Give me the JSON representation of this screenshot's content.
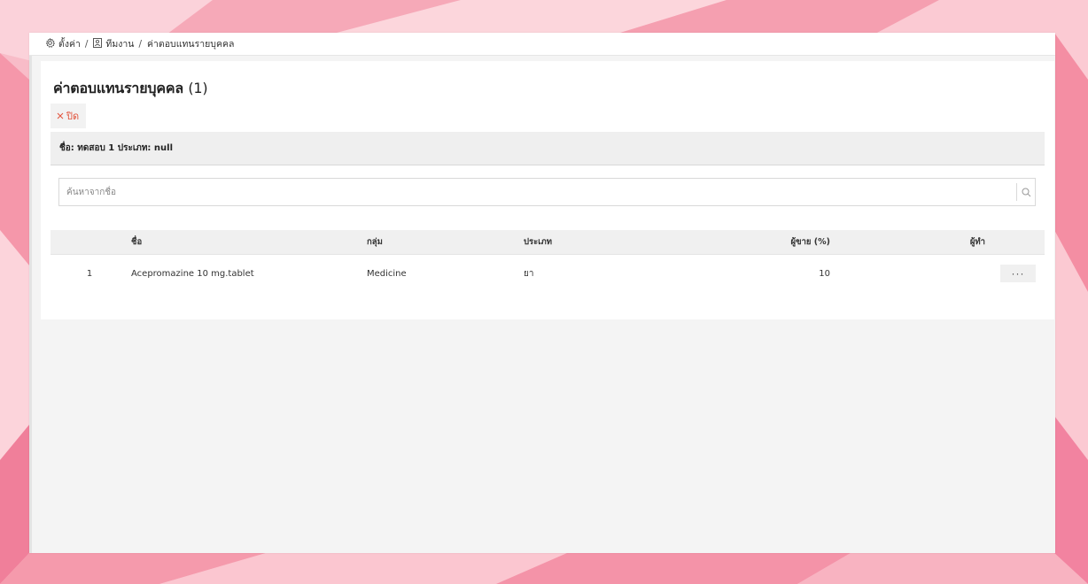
{
  "breadcrumb": {
    "items": [
      {
        "label": "ตั้งค่า",
        "icon": "gear-icon"
      },
      {
        "label": "ทีมงาน",
        "icon": "person-icon"
      },
      {
        "label": "ค่าตอบแทนรายบุคคล"
      }
    ],
    "separator": "/"
  },
  "page": {
    "title": "ค่าตอบแทนรายบุคคล",
    "count": "(1)",
    "close_label": "ปิด",
    "info": "ชื่อ: ทดสอบ 1 ประเภท: null"
  },
  "search": {
    "placeholder": "ค้นหาจากชื่อ",
    "value": ""
  },
  "table": {
    "columns": {
      "name": "ชื่อ",
      "group": "กลุ่ม",
      "type": "ประเภท",
      "seller": "ผู้ขาย (%)",
      "action": "ผู้ทำ"
    },
    "rows": [
      {
        "index": "1",
        "name": "Acepromazine 10 mg.tablet",
        "group": "Medicine",
        "type": "ยา",
        "seller": "10",
        "more": "···"
      }
    ]
  },
  "colors": {
    "background": "#f7b6c2",
    "close_text": "#e2533b",
    "panel": "#f4f4f4",
    "card": "#ffffff"
  }
}
